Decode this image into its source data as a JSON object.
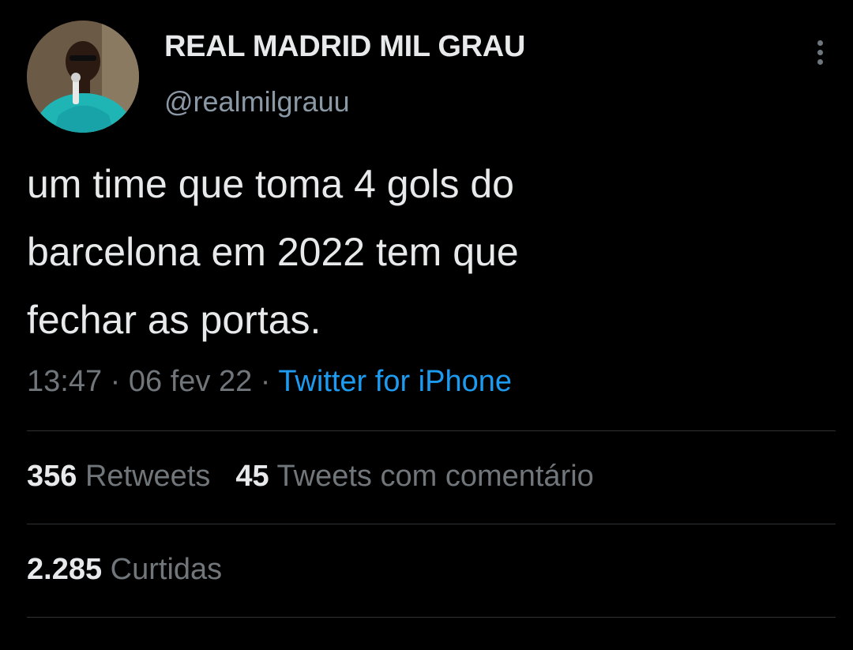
{
  "author": {
    "display_name": "REAL MADRID MIL GRAU",
    "handle": "@realmilgrauu",
    "avatar_icon": "profile-photo"
  },
  "more_icon": "more-vertical-icon",
  "tweet": {
    "lines": [
      "um time que toma 4 gols do",
      "barcelona em 2022 tem que",
      "fechar as portas."
    ],
    "time": "13:47",
    "date": "06 fev 22",
    "separator": "·",
    "source": "Twitter for iPhone"
  },
  "stats": {
    "retweets_count": "356",
    "retweets_label": "Retweets",
    "quotes_count": "45",
    "quotes_label": "Tweets com comentário",
    "likes_count": "2.285",
    "likes_label": "Curtidas"
  },
  "colors": {
    "background": "#000000",
    "text": "#e7e9ea",
    "secondary": "#71767b",
    "link": "#1d9bf0",
    "divider": "#2f3336"
  }
}
